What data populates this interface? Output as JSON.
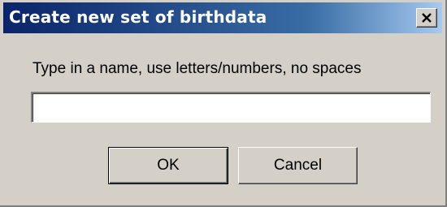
{
  "window": {
    "title": "Create new set of birthdata",
    "close_icon": "close-icon"
  },
  "form": {
    "prompt": "Type in a name, use letters/numbers, no spaces",
    "name_value": "",
    "name_placeholder": ""
  },
  "buttons": {
    "ok_label": "OK",
    "cancel_label": "Cancel"
  },
  "colors": {
    "titlebar_start": "#0a246a",
    "titlebar_end": "#a6caf0",
    "dialog_face": "#d4d0c8"
  }
}
